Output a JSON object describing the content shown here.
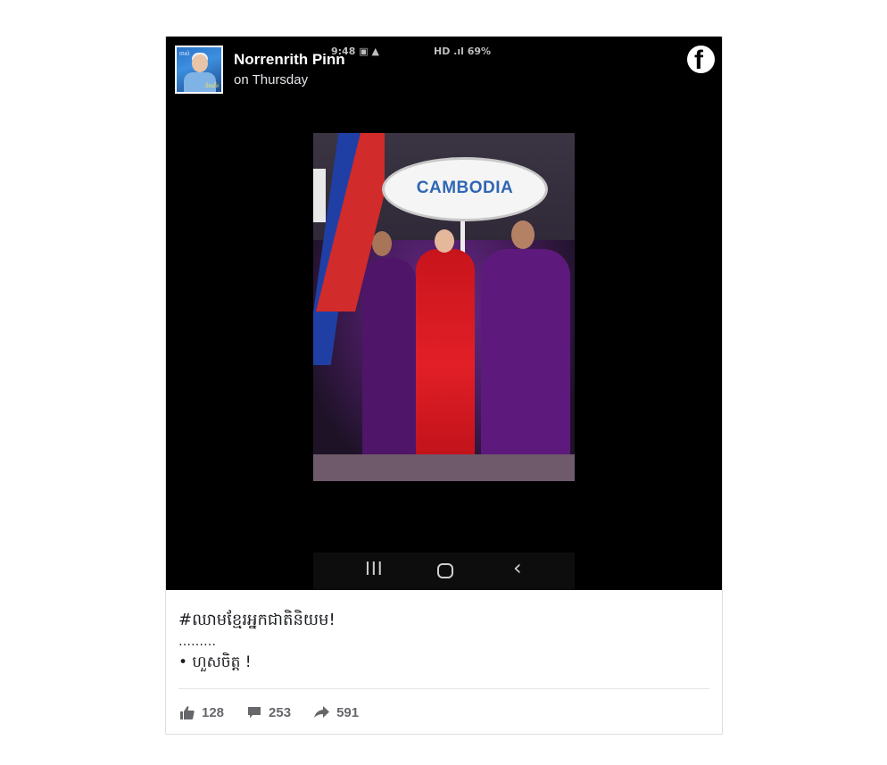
{
  "post": {
    "author": "Norrenrith Pinn",
    "time": "on Thursday",
    "avatar_text_top": "ចាស់",
    "avatar_text_bottom": "ដំណើរ"
  },
  "phone_status": {
    "time": "9:48",
    "right": "HD .ıl 69%"
  },
  "photo": {
    "sign_text": "CAMBODIA"
  },
  "navbar": {
    "recent": "III",
    "back": "‹"
  },
  "caption": {
    "line1": "#ឈាមខ្មែរអ្នកជាតិនិយម!",
    "line2": "………",
    "line3": "• ហួសចិត្ត !"
  },
  "stats": {
    "likes": "128",
    "comments": "253",
    "shares": "591"
  },
  "icons": {
    "brand": "facebook-icon",
    "like": "thumbs-up-icon",
    "comment": "comment-icon",
    "share": "share-arrow-icon"
  }
}
